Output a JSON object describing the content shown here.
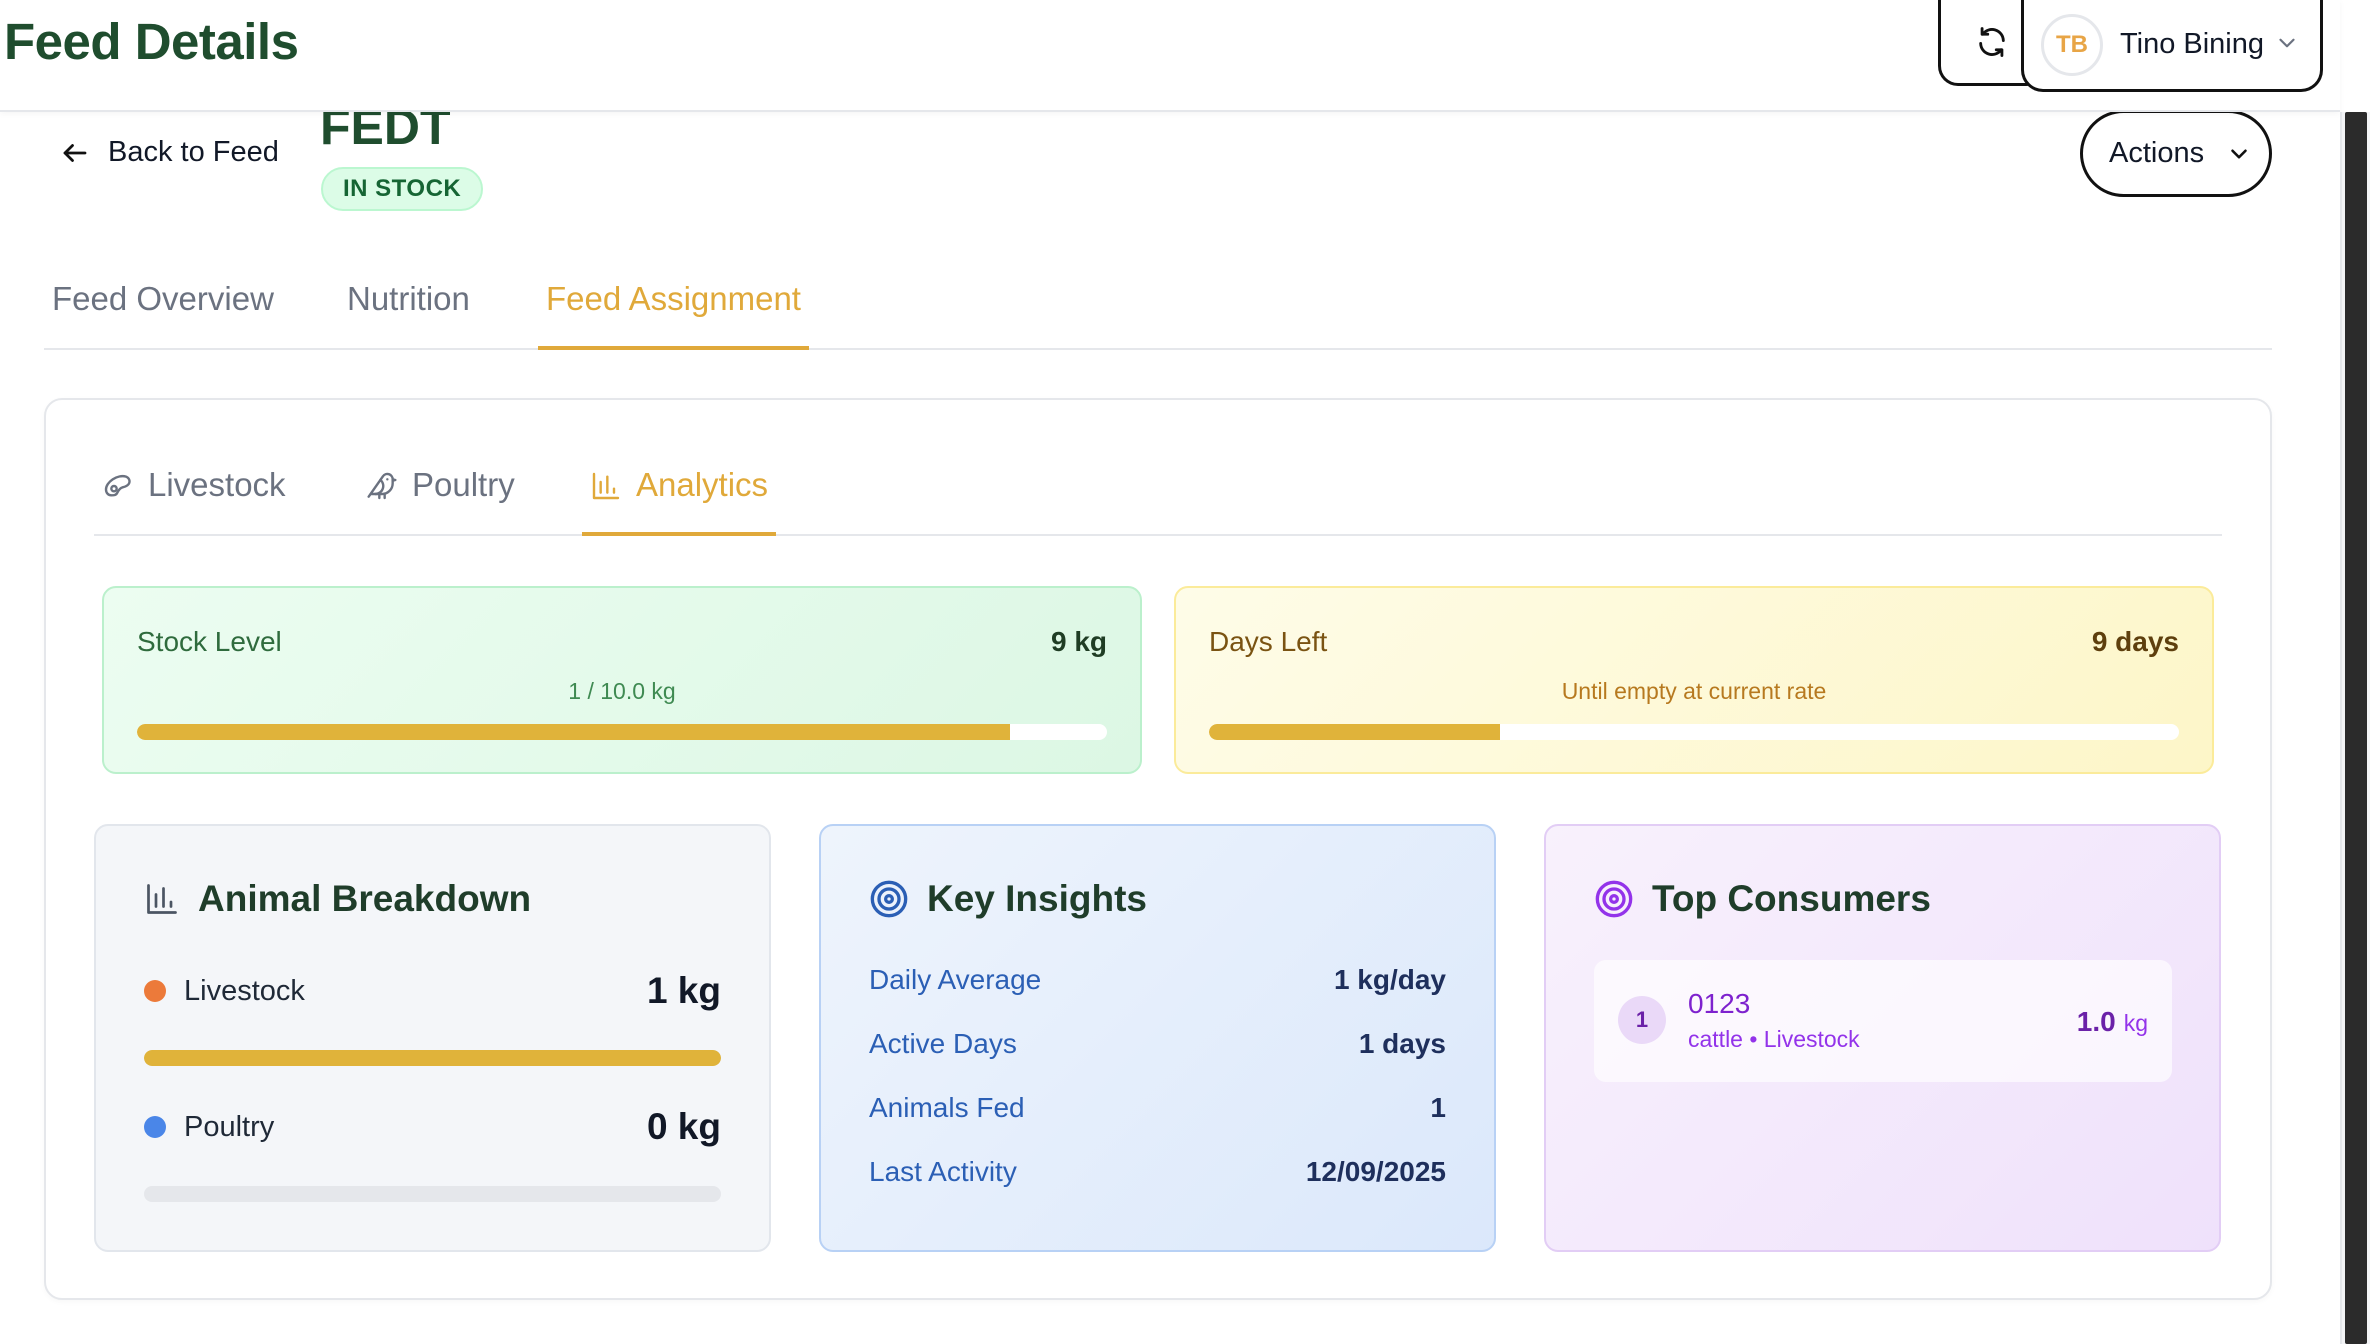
{
  "header": {
    "title": "Feed Details",
    "user": {
      "initials": "TB",
      "name": "Tino Bining"
    }
  },
  "feed": {
    "back_label": "Back to Feed",
    "name": "FEDT",
    "status": "IN STOCK",
    "actions_label": "Actions"
  },
  "main_tabs": [
    {
      "label": "Feed Overview",
      "active": false
    },
    {
      "label": "Nutrition",
      "active": false
    },
    {
      "label": "Feed Assignment",
      "active": true
    }
  ],
  "sub_tabs": [
    {
      "label": "Livestock",
      "icon": "livestock-icon",
      "active": false
    },
    {
      "label": "Poultry",
      "icon": "bird-icon",
      "active": false
    },
    {
      "label": "Analytics",
      "icon": "bar-chart-icon",
      "active": true
    }
  ],
  "stock_level": {
    "label": "Stock Level",
    "value": "9 kg",
    "sub": "1 / 10.0 kg",
    "fill_percent": 90
  },
  "days_left": {
    "label": "Days Left",
    "value": "9 days",
    "sub": "Until empty at current rate",
    "fill_percent": 30
  },
  "animal_breakdown": {
    "title": "Animal Breakdown",
    "items": [
      {
        "label": "Livestock",
        "value": "1 kg",
        "color": "#ec7a3a",
        "fill_percent": 100
      },
      {
        "label": "Poultry",
        "value": "0 kg",
        "color": "#4a86e8",
        "fill_percent": 0
      }
    ]
  },
  "key_insights": {
    "title": "Key Insights",
    "rows": [
      {
        "label": "Daily Average",
        "value": "1 kg/day"
      },
      {
        "label": "Active Days",
        "value": "1 days"
      },
      {
        "label": "Animals Fed",
        "value": "1"
      },
      {
        "label": "Last Activity",
        "value": "12/09/2025"
      }
    ]
  },
  "top_consumers": {
    "title": "Top Consumers",
    "items": [
      {
        "rank": "1",
        "name": "0123",
        "sub": "cattle • Livestock",
        "amount": "1.0",
        "unit": "kg"
      }
    ]
  },
  "colors": {
    "brand_green": "#1f4d2e",
    "accent": "#e0a93a",
    "bar_fill": "#e0b33a"
  }
}
